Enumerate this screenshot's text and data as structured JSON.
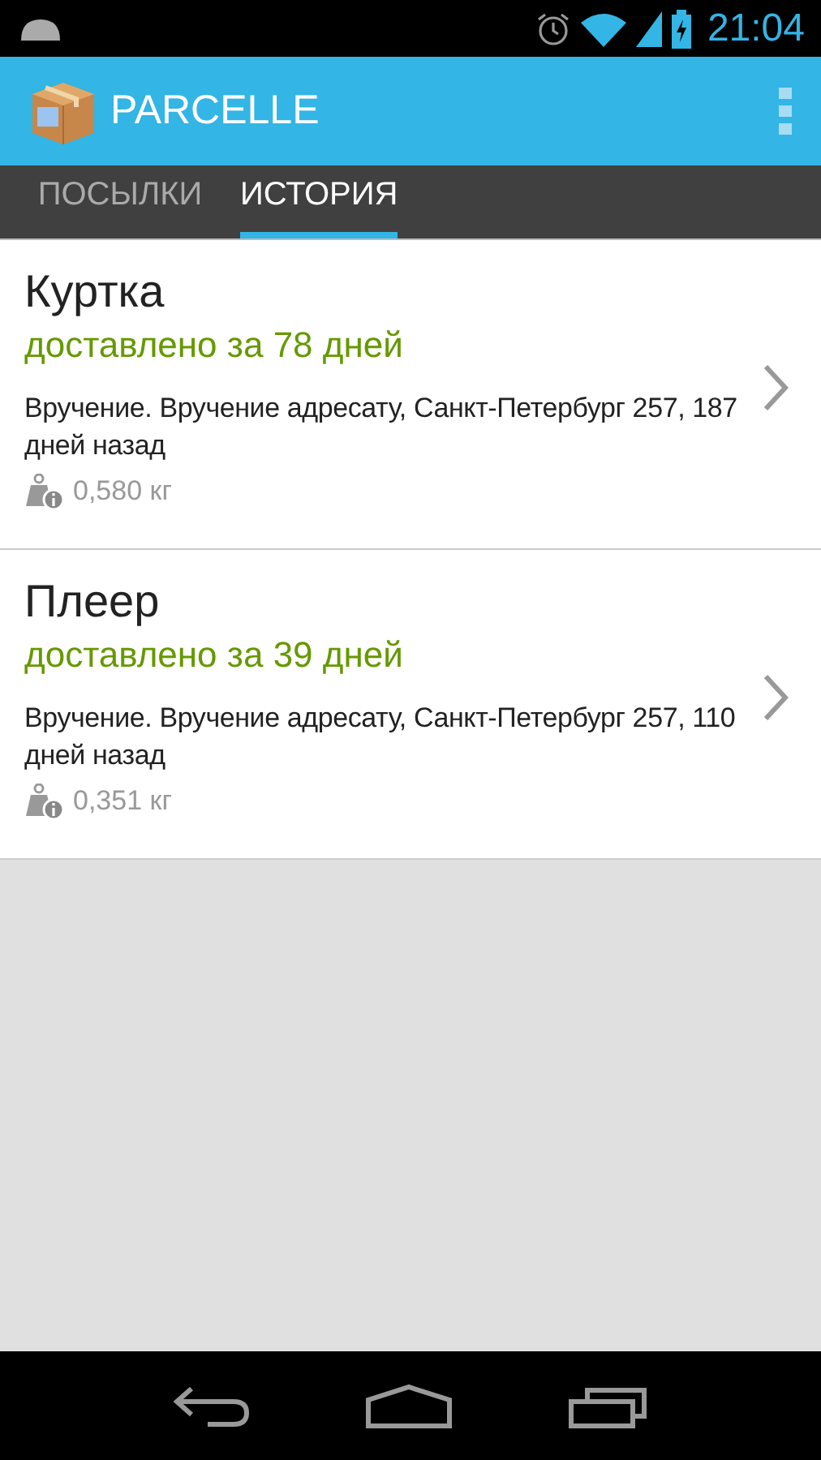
{
  "status_bar": {
    "time": "21:04"
  },
  "action_bar": {
    "title": "PARCELLE"
  },
  "tabs": [
    {
      "label": "ПОСЫЛКИ",
      "selected": false
    },
    {
      "label": "ИСТОРИЯ",
      "selected": true
    }
  ],
  "parcels": [
    {
      "name": "Куртка",
      "status": "доставлено за 78 дней",
      "event": "Вручение. Вручение адресату, Санкт-Петербург 257, 187 дней назад",
      "weight": "0,580 кг"
    },
    {
      "name": "Плеер",
      "status": "доставлено за 39 дней",
      "event": "Вручение. Вручение адресату, Санкт-Петербург 257, 110 дней назад",
      "weight": "0,351 кг"
    }
  ]
}
